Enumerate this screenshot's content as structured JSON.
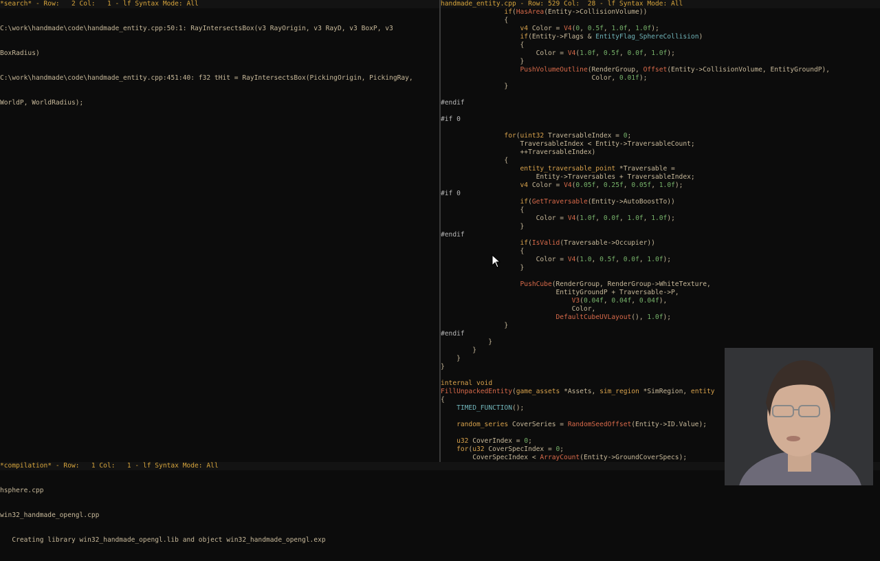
{
  "left_pane": {
    "modeline": "*search* - Row:   2 Col:   1 - lf Syntax Mode: All",
    "lines": [
      "C:\\work\\handmade\\code\\handmade_entity.cpp:50:1: RayIntersectsBox(v3 RayOrigin, v3 RayD, v3 BoxP, v3",
      "BoxRadius)",
      "C:\\work\\handmade\\code\\handmade_entity.cpp:451:40: f32 tHit = RayIntersectsBox(PickingOrigin, PickingRay,",
      "WorldP, WorldRadius);"
    ]
  },
  "right_pane": {
    "modeline": "handmade_entity.cpp - Row: 529 Col:  28 - lf Syntax Mode: All",
    "code": [
      "                if(HasArea(Entity->CollisionVolume))",
      "                {",
      "                    v4 Color = V4(0, 0.5f, 1.0f, 1.0f);",
      "                    if(Entity->Flags & EntityFlag_SphereCollision)",
      "                    {",
      "                        Color = V4(1.0f, 0.5f, 0.0f, 1.0f);",
      "                    }",
      "                    PushVolumeOutline(RenderGroup, Offset(Entity->CollisionVolume, EntityGroundP),",
      "                                      Color, 0.01f);",
      "                }",
      "",
      "#endif",
      "",
      "#if 0",
      "",
      "                for(uint32 TraversableIndex = 0;",
      "                    TraversableIndex < Entity->TraversableCount;",
      "                    ++TraversableIndex)",
      "                {",
      "                    entity_traversable_point *Traversable =",
      "                        Entity->Traversables + TraversableIndex;",
      "                    v4 Color = V4(0.05f, 0.25f, 0.05f, 1.0f);",
      "#if 0",
      "                    if(GetTraversable(Entity->AutoBoostTo))",
      "                    {",
      "                        Color = V4(1.0f, 0.0f, 1.0f, 1.0f);",
      "                    }",
      "#endif",
      "                    if(IsValid(Traversable->Occupier))",
      "                    {",
      "                        Color = V4(1.0, 0.5f, 0.0f, 1.0f);",
      "                    }",
      "",
      "                    PushCube(RenderGroup, RenderGroup->WhiteTexture,",
      "                             EntityGroundP + Traversable->P,",
      "                                 V3(0.04f, 0.04f, 0.04f),",
      "                                 Color,",
      "                             DefaultCubeUVLayout(), 1.0f);",
      "                }",
      "#endif",
      "            }",
      "        }",
      "    }",
      "}",
      "",
      "internal void",
      "FillUnpackedEntity(game_assets *Assets, sim_region *SimRegion, entity",
      "{",
      "    TIMED_FUNCTION();",
      "",
      "    random_series CoverSeries = RandomSeedOffset(Entity->ID.Value);",
      "",
      "    u32 CoverIndex = 0;",
      "    for(u32 CoverSpecIndex = 0;",
      "        CoverSpecIndex < ArrayCount(Entity->GroundCoverSpecs);"
    ]
  },
  "bottom_pane": {
    "modeline": "*compilation* - Row:   1 Col:   1 - lf Syntax Mode: All",
    "lines": [
      "hsphere.cpp",
      "win32_handmade_opengl.cpp",
      "   Creating library win32_handmade_opengl.lib and object win32_handmade_opengl.exp"
    ]
  },
  "colors": {
    "background": "#0c0c0c",
    "modeline": "#d6a43c",
    "keyword": "#d8a24c",
    "function": "#d96a4a",
    "number": "#77b36a",
    "macro": "#6fb3b8"
  }
}
